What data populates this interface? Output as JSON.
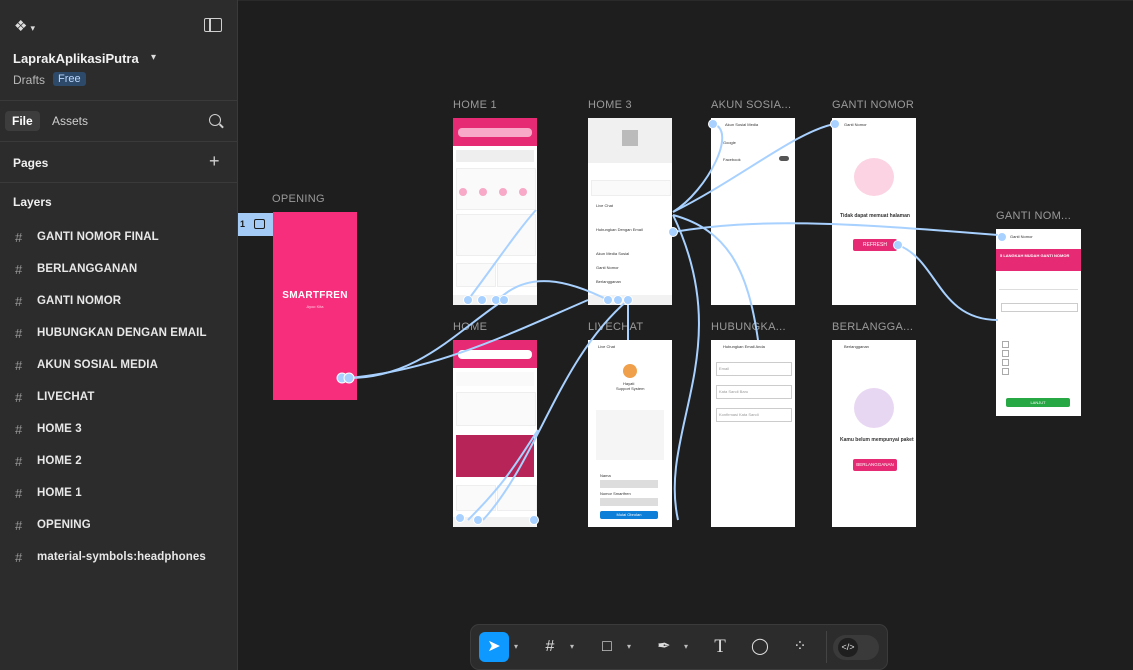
{
  "sidebar": {
    "project_title": "LaprakAplikasiPutra",
    "drafts_label": "Drafts",
    "plan_badge": "Free",
    "tabs": {
      "file": "File",
      "assets": "Assets"
    },
    "pages_label": "Pages",
    "layers_label": "Layers",
    "layers": [
      "GANTI NOMOR FINAL",
      "BERLANGGANAN",
      "GANTI NOMOR",
      "HUBUNGKAN DENGAN EMAIL",
      "AKUN SOSIAL MEDIA",
      "LIVECHAT",
      "HOME 3",
      "HOME 2",
      "HOME 1",
      "OPENING",
      "material-symbols:headphones"
    ]
  },
  "canvas": {
    "selection_count": "1",
    "frame_labels": {
      "opening": "OPENING",
      "home1": "HOME 1",
      "home3": "HOME 3",
      "akun": "AKUN SOSIA...",
      "ganti": "GANTI NOMOR",
      "ganti_final": "GANTI NOM...",
      "home2": "HOME",
      "livechat": "LIVECHAT",
      "hubungkan": "HUBUNGKA...",
      "berlangganan": "BERLANGGA..."
    },
    "opening": {
      "brand": "SMARTFREN",
      "sub": "Ayoo Kita"
    },
    "ganti": {
      "message": "Tidak dapat memuat halaman",
      "button": "REFRESH",
      "header": "Ganti Nomor"
    },
    "berlangganan": {
      "header": "Berlangganan",
      "message": "Kamu belum mempunyai paket",
      "button": "BERLANGGANAN"
    },
    "hubungkan": {
      "header": "Hubungkan Email Anda",
      "fields": [
        "Email",
        "Kata Sandi Baru",
        "Konfirmasi Kata Sandi"
      ]
    },
    "akun": {
      "header": "Akun Sosial Media",
      "items": [
        "Google",
        "Facebook"
      ]
    },
    "livechat": {
      "header": "Live Chat",
      "agent": "Hayati",
      "agent_role": "Support System",
      "name_label": "Nama",
      "phone_label": "Nomor Smartfren",
      "button": "Mulai Obrolan"
    },
    "home3": {
      "items": [
        "Live Chat",
        "Hubungkan Dengan Email",
        "Akun Media Sosial",
        "Ganti Nomor",
        "Berlangganan"
      ]
    },
    "ganti_final": {
      "header": "Ganti Nomor",
      "banner": "5 LANGKAH MUDAH GANTI NOMOR",
      "button": "LANJUT"
    }
  },
  "toolbar": {
    "tools": [
      "move-tool",
      "frame-tool",
      "shape-tool",
      "pen-tool",
      "text-tool",
      "comment-tool",
      "actions-tool"
    ],
    "dev_mode": "</>"
  },
  "colors": {
    "accent": "#0d99ff",
    "brand_pink": "#f72e7c",
    "connector": "#a8d1ff"
  }
}
